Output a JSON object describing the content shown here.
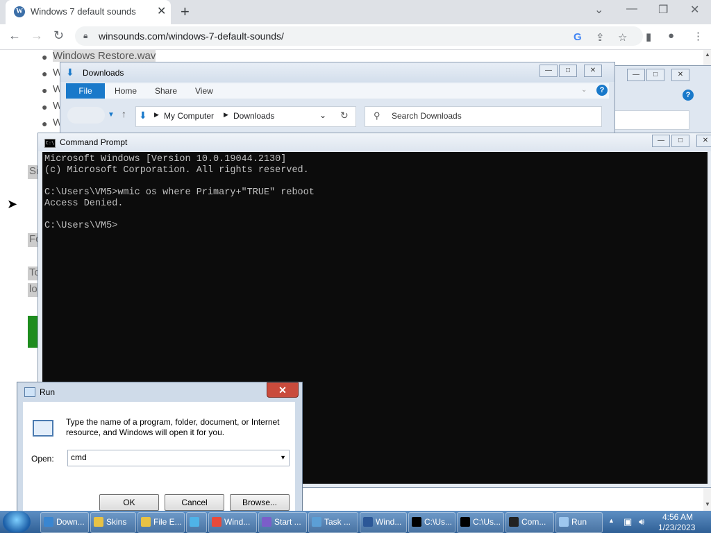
{
  "browser": {
    "tab_title": "Windows 7 default sounds",
    "tab_favicon": "wordpress-icon",
    "url": "winsounds.com/windows-7-default-sounds/"
  },
  "webpage": {
    "list_items": [
      "Windows Restore.wav",
      "W",
      "W",
      "W",
      "W"
    ],
    "side_snippets": [
      "Si",
      "Fo",
      "To",
      "lo"
    ]
  },
  "explorer": {
    "title": "Downloads",
    "ribbon_tabs": [
      "File",
      "Home",
      "Share",
      "View"
    ],
    "breadcrumb": [
      "My Computer",
      "Downloads"
    ],
    "search_placeholder": "Search Downloads"
  },
  "cmd": {
    "title": "Command Prompt",
    "lines": [
      "Microsoft Windows [Version 10.0.19044.2130]",
      "(c) Microsoft Corporation. All rights reserved.",
      "",
      "C:\\Users\\VM5>wmic os where Primary+\"TRUE\" reboot",
      "Access Denied.",
      "",
      "C:\\Users\\VM5>"
    ]
  },
  "run": {
    "title": "Run",
    "close": "✕",
    "description": "Type the name of a program, folder, document, or Internet resource, and Windows will open it for you.",
    "open_label": "Open:",
    "open_value": "cmd",
    "ok": "OK",
    "cancel": "Cancel",
    "browse": "Browse..."
  },
  "taskbar": {
    "buttons": [
      {
        "label": "Down...",
        "icon": "download-folder-icon"
      },
      {
        "label": "Skins",
        "icon": "folder-icon"
      },
      {
        "label": "File E...",
        "icon": "file-explorer-icon"
      },
      {
        "label": "",
        "icon": "app-icon"
      },
      {
        "label": "Wind...",
        "icon": "chrome-icon"
      },
      {
        "label": "Start ...",
        "icon": "visual-studio-icon"
      },
      {
        "label": "Task ...",
        "icon": "task-manager-icon"
      },
      {
        "label": "Wind...",
        "icon": "word-icon"
      },
      {
        "label": "C:\\Us...",
        "icon": "7zip-icon"
      },
      {
        "label": "C:\\Us...",
        "icon": "7zip-icon"
      },
      {
        "label": "Com...",
        "icon": "cmd-icon"
      },
      {
        "label": "Run",
        "icon": "run-icon"
      }
    ],
    "time": "4:56 AM",
    "date": "1/23/2023"
  }
}
